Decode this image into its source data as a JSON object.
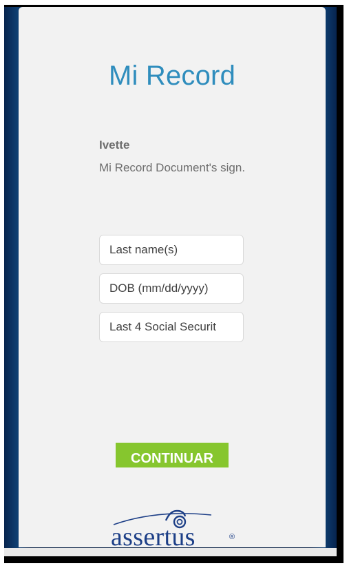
{
  "app": {
    "title": "Mi Record"
  },
  "intro": {
    "name": "Ivette",
    "message": "Mi Record Document's sign."
  },
  "form": {
    "last_name_placeholder": "Last name(s)",
    "dob_placeholder": "DOB (mm/dd/yyyy)",
    "ssn_placeholder": "Last 4 Social Securit",
    "continue_label": "CONTINUAR"
  },
  "brand": {
    "logo_text": "assertus",
    "registered_mark": "®"
  },
  "colors": {
    "title": "#2f8dbd",
    "button": "#86c62e",
    "logo": "#1d3f87",
    "text": "#6d6d6d"
  }
}
